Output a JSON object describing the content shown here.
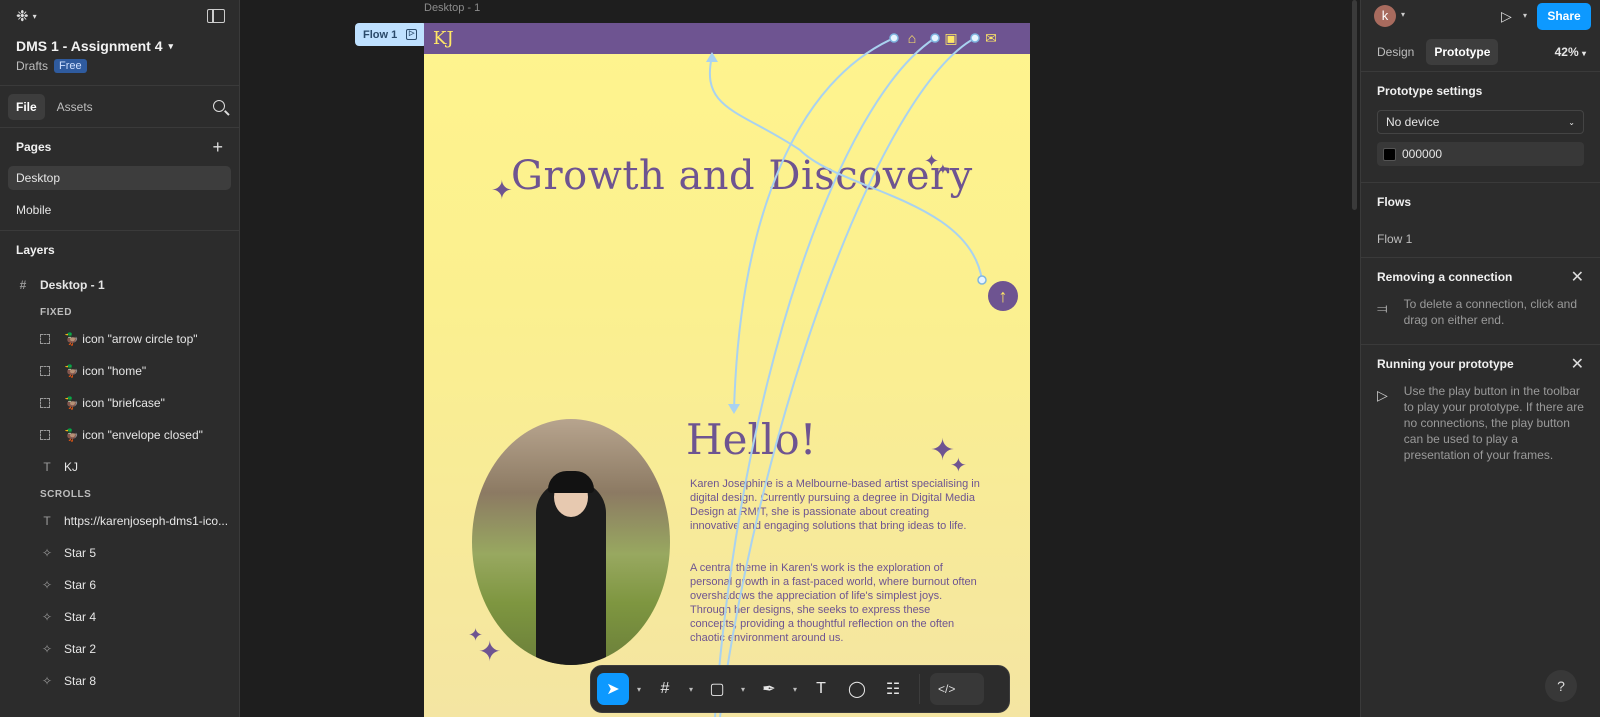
{
  "left": {
    "project_name": "DMS 1 - Assignment 4",
    "project_location": "Drafts",
    "plan_badge": "Free",
    "tabs": [
      {
        "label": "File"
      },
      {
        "label": "Assets"
      }
    ],
    "pages_heading": "Pages",
    "pages": [
      {
        "label": "Desktop"
      },
      {
        "label": "Mobile"
      }
    ],
    "layers_heading": "Layers",
    "root_layer": "Desktop - 1",
    "group_fixed": "FIXED",
    "group_scrolls": "SCROLLS",
    "fixed_layers": [
      {
        "label": "🦆 icon \"arrow circle top\""
      },
      {
        "label": "🦆 icon \"home\""
      },
      {
        "label": "🦆 icon \"briefcase\""
      },
      {
        "label": "🦆 icon \"envelope closed\""
      },
      {
        "label": "KJ"
      }
    ],
    "scroll_layers": [
      {
        "label": "https://karenjoseph-dms1-ico..."
      },
      {
        "label": "Star 5"
      },
      {
        "label": "Star 6"
      },
      {
        "label": "Star 4"
      },
      {
        "label": "Star 2"
      },
      {
        "label": "Star 8"
      }
    ]
  },
  "canvas": {
    "frame_label": "Desktop - 1",
    "flow_pill": "Flow 1",
    "site": {
      "logo": "KJ",
      "headline": "Growth and Discovery",
      "hello": "Hello!",
      "para1": "Karen Josephine is a Melbourne-based artist specialising in digital design. Currently pursuing a degree in Digital Media Design at RMIT, she is passionate about creating innovative and engaging solutions that bring ideas to life.",
      "para2": "A central theme in Karen's work is the exploration of personal growth in a fast-paced world, where burnout often overshadows the appreciation of life's simplest joys. Through her designs, she seeks to express these concepts, providing a thoughtful reflection on the often chaotic environment around us."
    }
  },
  "toolbar": {
    "tools": [
      "move-tool",
      "frame-tool",
      "shape-tool",
      "pen-tool",
      "text-tool",
      "comment-tool",
      "actions-tool"
    ],
    "dev_mode_label": "</>"
  },
  "right": {
    "avatar_initial": "k",
    "share_label": "Share",
    "tabs": [
      {
        "label": "Design"
      },
      {
        "label": "Prototype"
      }
    ],
    "zoom": "42%",
    "proto_settings_heading": "Prototype settings",
    "device_value": "No device",
    "bg_color": "000000",
    "flows_heading": "Flows",
    "flow_item": "Flow 1",
    "removing_heading": "Removing a connection",
    "removing_text": "To delete a connection, click and drag on either end.",
    "running_heading": "Running your prototype",
    "running_text": "Use the play button in the toolbar to play your prototype. If there are no connections, the play button can be used to play a presentation of your frames.",
    "help_label": "?"
  },
  "colors": {
    "accent": "#0d99ff",
    "site_purple": "#6e5491",
    "site_yellow": "#fff48e",
    "wire_blue": "#a9d2f0"
  }
}
